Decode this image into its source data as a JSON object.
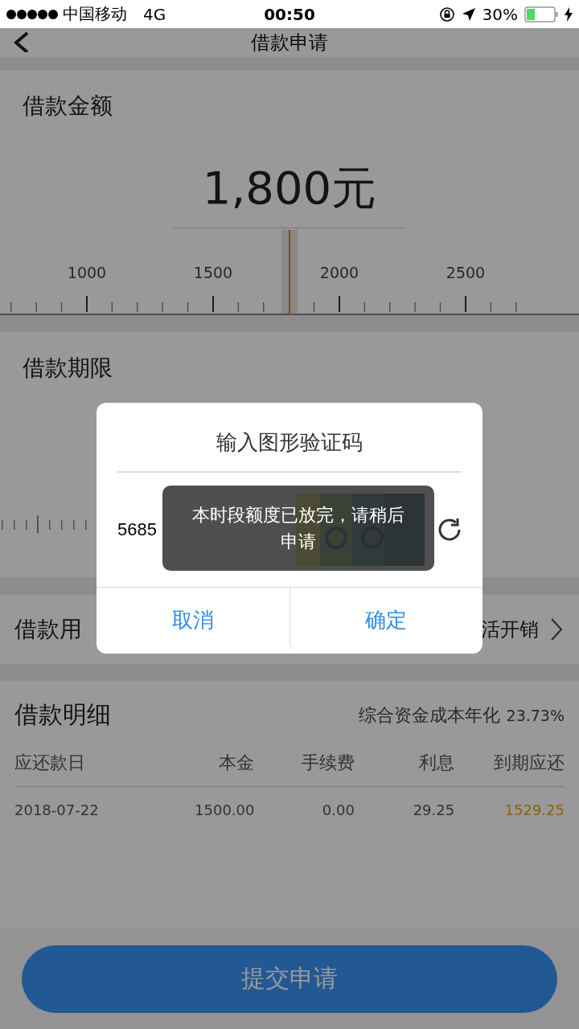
{
  "status_bar": {
    "carrier": "中国移动",
    "network": "4G",
    "time": "00:50",
    "battery": "30%"
  },
  "nav": {
    "title": "借款申请"
  },
  "amount": {
    "label": "借款金额",
    "value": "1,800元",
    "level": 0.5,
    "ticks": [
      "1000",
      "1500",
      "2000",
      "2500"
    ]
  },
  "term": {
    "label": "借款期限"
  },
  "purpose": {
    "label": "借款用",
    "value": "活开销"
  },
  "detail": {
    "title": "借款明细",
    "rate_label": "综合资金成本年化",
    "rate": "23.73%",
    "columns": [
      "应还款日",
      "本金",
      "手续费",
      "利息",
      "到期应还"
    ],
    "rows": [
      {
        "cells": [
          "2018-07-22",
          "1500.00",
          "0.00",
          "29.25",
          "1529.25"
        ]
      }
    ]
  },
  "submit_button": "提交申请",
  "dialog": {
    "title": "输入图形验证码",
    "input_value": "5685",
    "buttons": [
      "取消",
      "确定"
    ]
  },
  "toast": "本时段额度已放完，请稍后申请"
}
